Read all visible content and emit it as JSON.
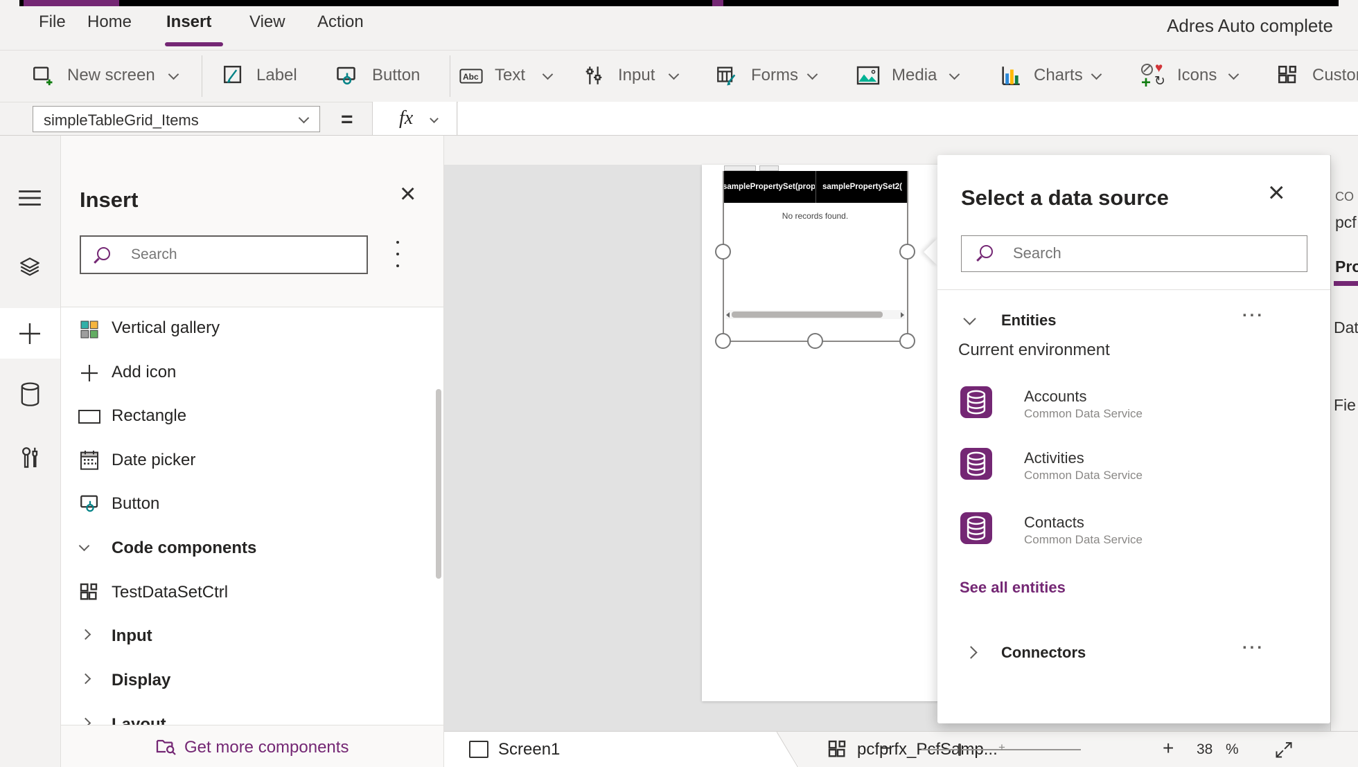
{
  "app": {
    "title": "Adres Auto complete"
  },
  "colors": {
    "accent_purple": "#742774",
    "teal": "#038387",
    "selection_gray": "#8a8886",
    "canvas_gray": "#e2e2e2"
  },
  "menu": {
    "items": [
      "File",
      "Home",
      "Insert",
      "View",
      "Action"
    ],
    "active_item": "Insert"
  },
  "ribbon": {
    "new_screen": "New screen",
    "label": "Label",
    "button": "Button",
    "text": "Text",
    "input": "Input",
    "forms": "Forms",
    "media": "Media",
    "charts": "Charts",
    "icons": "Icons",
    "custom": "Custom"
  },
  "formula_bar": {
    "property_selector": "simpleTableGrid_Items",
    "equals": "=",
    "fx": "fx"
  },
  "insert_panel": {
    "title": "Insert",
    "search_placeholder": "Search",
    "items": [
      {
        "label": "Vertical gallery"
      },
      {
        "label": "Add icon"
      },
      {
        "label": "Rectangle"
      },
      {
        "label": "Date picker"
      },
      {
        "label": "Button"
      },
      {
        "label": "Code components"
      },
      {
        "label": "TestDataSetCtrl"
      },
      {
        "label": "Input"
      },
      {
        "label": "Display"
      },
      {
        "label": "Layout"
      }
    ],
    "footer_link": "Get more components"
  },
  "canvas": {
    "grid": {
      "headers": [
        "samplePropertySet(prop",
        "samplePropertySet2("
      ],
      "empty_message": "No records found."
    }
  },
  "flyout": {
    "title": "Select a data source",
    "search_placeholder": "Search",
    "entities_section": "Entities",
    "environment_label": "Current environment",
    "entities": [
      {
        "name": "Accounts",
        "service": "Common Data Service"
      },
      {
        "name": "Activities",
        "service": "Common Data Service"
      },
      {
        "name": "Contacts",
        "service": "Common Data Service"
      }
    ],
    "see_all_link": "See all entities",
    "connectors_section": "Connectors"
  },
  "right_panel": {
    "fragments": {
      "line1": "CO",
      "line2": "pcf",
      "tab": "Pro",
      "field1": "Dat",
      "field2": "Fie"
    }
  },
  "bottom_bar": {
    "screen_tab": "Screen1",
    "component_breadcrumb": "pcfprfx_PcfSamp...",
    "zoom_minus": "−",
    "zoom_plus": "+",
    "zoom_value": "38",
    "zoom_percent": "%"
  },
  "glyphs": {
    "close": "×",
    "heart": "♥",
    "refresh": "↻",
    "dots": "..."
  }
}
